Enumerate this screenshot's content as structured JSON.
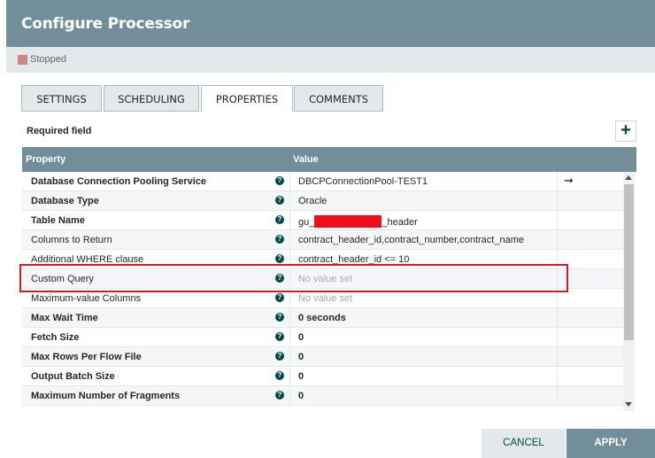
{
  "dialog": {
    "title": "Configure Processor",
    "status": "Stopped",
    "status_color": "#d18686",
    "tabs": [
      {
        "label": "SETTINGS"
      },
      {
        "label": "SCHEDULING"
      },
      {
        "label": "PROPERTIES"
      },
      {
        "label": "COMMENTS"
      }
    ],
    "active_tab": "PROPERTIES",
    "required_field": "Required field",
    "add_icon": "plus-icon",
    "table": {
      "headers": [
        "Property",
        "Value"
      ],
      "rows": [
        {
          "name": "Database Connection Pooling Service",
          "value": "DBCPConnectionPool-TEST1",
          "required": true
        },
        {
          "name": "Database Type",
          "value": "Oracle",
          "required": true
        },
        {
          "name": "Table Name",
          "value_prefix": "gu_",
          "value_suffix": "_header",
          "required": true
        },
        {
          "name": "Columns to Return",
          "value": "contract_header_id,contract_number,contract_name",
          "required": false
        },
        {
          "name": "Additional WHERE clause",
          "value": "contract_header_id <= 10",
          "required": false
        },
        {
          "name": "Custom Query",
          "value": "No value set",
          "required": false
        },
        {
          "name": "Maximum-value Columns",
          "value": "No value set",
          "required": false
        },
        {
          "name": "Max Wait Time",
          "value": "0 seconds",
          "required": true
        },
        {
          "name": "Fetch Size",
          "value": "0",
          "required": true
        },
        {
          "name": "Max Rows Per Flow File",
          "value": "0",
          "required": true
        },
        {
          "name": "Output Batch Size",
          "value": "0",
          "required": true
        },
        {
          "name": "Maximum Number of Fragments",
          "value": "0",
          "required": true
        }
      ]
    },
    "buttons": {
      "cancel": "CANCEL",
      "apply": "APPLY"
    }
  }
}
